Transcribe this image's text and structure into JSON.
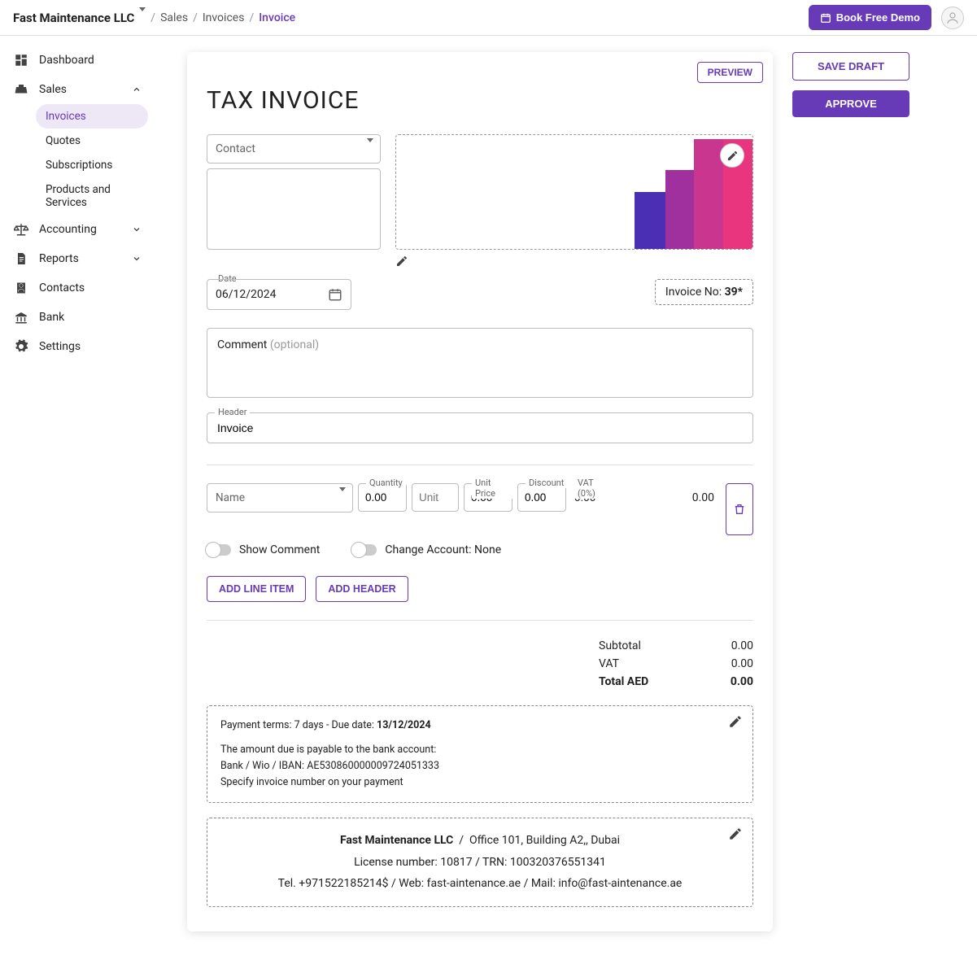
{
  "topbar": {
    "company": "Fast Maintenance LLC",
    "crumbs": [
      "Sales",
      "Invoices",
      "Invoice"
    ],
    "demo_btn": "Book Free Demo"
  },
  "sidebar": {
    "dashboard": "Dashboard",
    "sales": "Sales",
    "sales_items": {
      "invoices": "Invoices",
      "quotes": "Quotes",
      "subscriptions": "Subscriptions",
      "products": "Products and Services"
    },
    "accounting": "Accounting",
    "reports": "Reports",
    "contacts": "Contacts",
    "bank": "Bank",
    "settings": "Settings"
  },
  "actions": {
    "save_draft": "SAVE DRAFT",
    "approve": "APPROVE",
    "preview": "PREVIEW"
  },
  "invoice": {
    "title": "TAX INVOICE",
    "contact_placeholder": "Contact",
    "date_label": "Date",
    "date_value": "06/12/2024",
    "invoice_no_label": "Invoice No: ",
    "invoice_no_value": "39*",
    "comment_label": "Comment ",
    "comment_optional": "(optional)",
    "header_label": "Header",
    "header_value": "Invoice",
    "line": {
      "name_placeholder": "Name",
      "qty_label": "Quantity",
      "qty_value": "0.00",
      "unit_placeholder": "Unit",
      "unitprice_label": "Unit Price",
      "unitprice_value": "0.00",
      "discount_label": "Discount",
      "discount_value": "0.00",
      "vat_label": "VAT (0%)",
      "vat_value": "0.00",
      "line_total": "0.00"
    },
    "toggles": {
      "show_comment": "Show Comment",
      "change_account": "Change Account: None"
    },
    "add_line": "ADD LINE ITEM",
    "add_header": "ADD HEADER",
    "totals": {
      "subtotal_label": "Subtotal",
      "subtotal": "0.00",
      "vat_label": "VAT",
      "vat": "0.00",
      "total_label": "Total AED",
      "total": "0.00"
    },
    "terms": {
      "line1a": "Payment terms: 7 days - Due date: ",
      "line1b": "13/12/2024",
      "line2": "The amount due is payable to the bank account:",
      "line3": "Bank / Wio / IBAN: AE530860000009724051333",
      "line4": "Specify invoice number on your payment"
    },
    "footer": {
      "company": "Fast Maintenance LLC",
      "address": "Office 101, Building A2,, Dubai",
      "license": "License number: 10817 / TRN: 100320376551341",
      "contact": "Tel. +971522185214$ / Web: fast-aintenance.ae / Mail: info@fast-aintenance.ae"
    }
  }
}
